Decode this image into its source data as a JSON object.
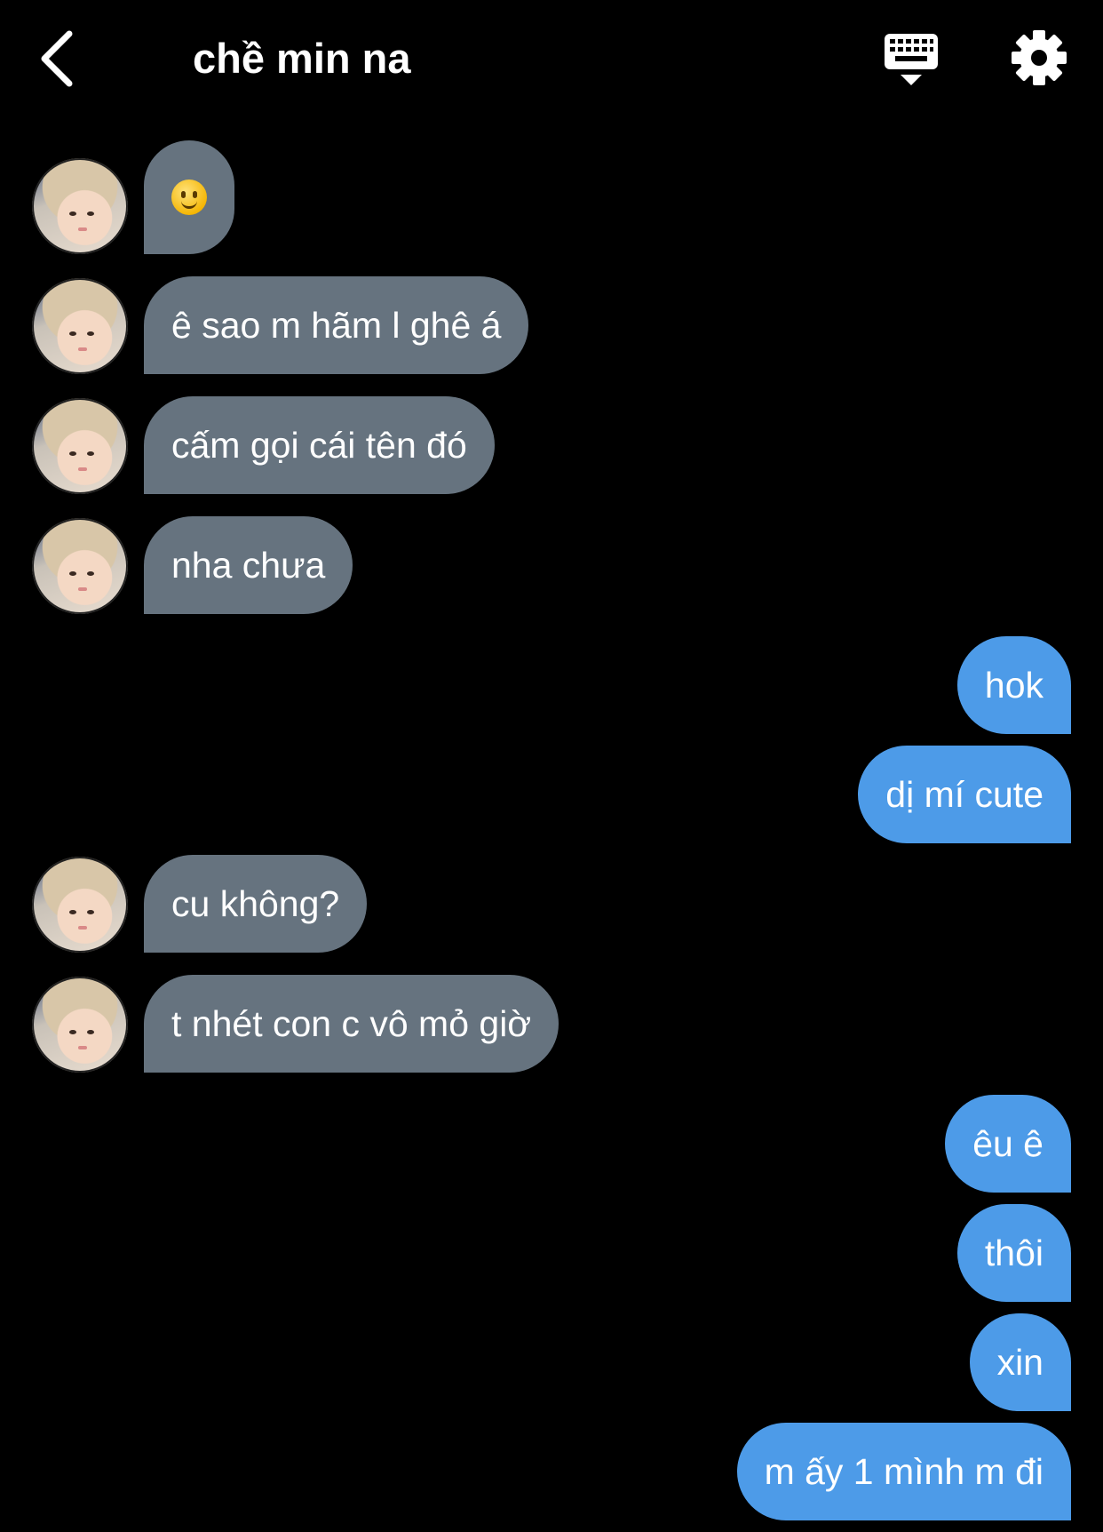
{
  "header": {
    "title": "chề min na",
    "back_icon": "chevron-left-icon",
    "keyboard_icon": "keyboard-icon",
    "settings_icon": "gear-icon"
  },
  "colors": {
    "background": "#000000",
    "incoming_bubble": "#66737f",
    "outgoing_bubble": "#4d9be8",
    "text": "#ffffff"
  },
  "messages": [
    {
      "side": "in",
      "text": "🙂",
      "emoji": "slightly-smiling-face-icon"
    },
    {
      "side": "in",
      "text": "ê sao m hãm l ghê á"
    },
    {
      "side": "in",
      "text": "cấm gọi cái tên đó"
    },
    {
      "side": "in",
      "text": "nha chưa"
    },
    {
      "side": "out",
      "text": "hok"
    },
    {
      "side": "out",
      "text": "dị mí cute"
    },
    {
      "side": "in",
      "text": "cu không?"
    },
    {
      "side": "in",
      "text": "t nhét con c vô mỏ giờ"
    },
    {
      "side": "out",
      "text": "êu ê"
    },
    {
      "side": "out",
      "text": "thôi"
    },
    {
      "side": "out",
      "text": "xin"
    },
    {
      "side": "out",
      "text": "m ấy 1 mình m đi"
    }
  ]
}
